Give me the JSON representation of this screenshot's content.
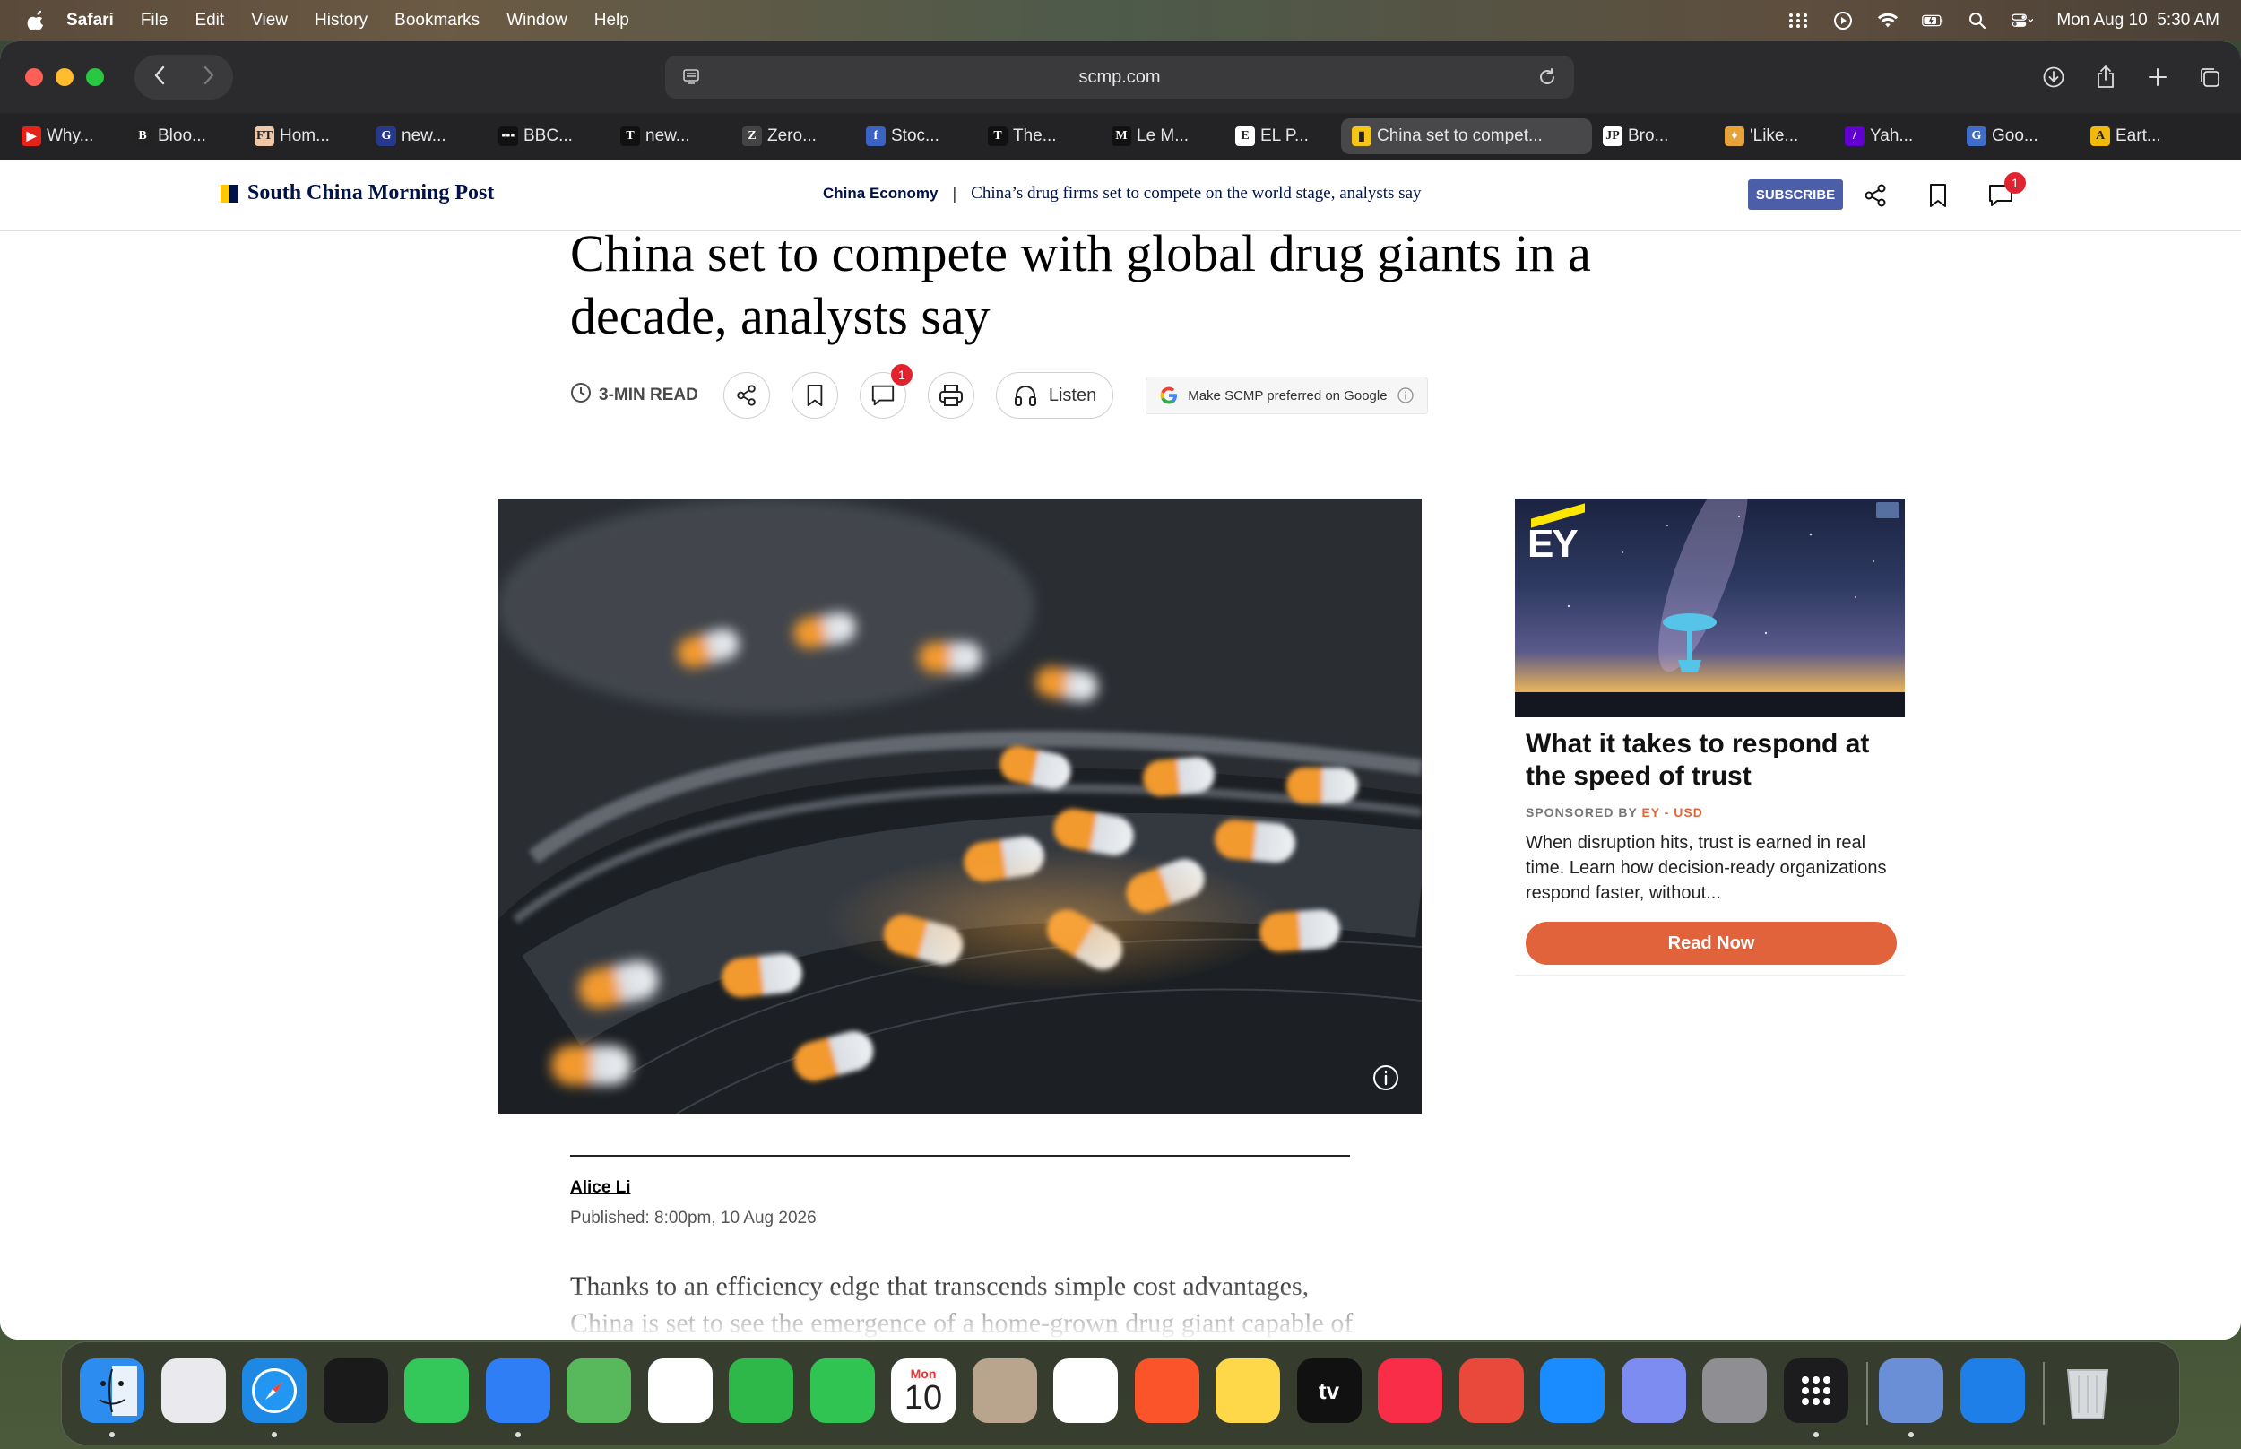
{
  "menubar": {
    "app_name": "Safari",
    "menus": [
      "File",
      "Edit",
      "View",
      "History",
      "Bookmarks",
      "Window",
      "Help"
    ],
    "datetime": "Mon Aug 10  5:30 AM"
  },
  "browser": {
    "address": "scmp.com",
    "tabs": [
      {
        "label": "Why...",
        "fav": "▶",
        "color": "#e62117"
      },
      {
        "label": "Bloo...",
        "fav": "B",
        "color": "#222"
      },
      {
        "label": "Hom...",
        "fav": "FT",
        "color": "#f0c8a8"
      },
      {
        "label": "new...",
        "fav": "G",
        "color": "#27388f"
      },
      {
        "label": "BBC...",
        "fav": "▪▪▪",
        "color": "#111"
      },
      {
        "label": "new...",
        "fav": "T",
        "color": "#111"
      },
      {
        "label": "Zero...",
        "fav": "Z",
        "color": "#444"
      },
      {
        "label": "Stoc...",
        "fav": "f",
        "color": "#3b63c4"
      },
      {
        "label": "The...",
        "fav": "T",
        "color": "#111"
      },
      {
        "label": "Le M...",
        "fav": "M",
        "color": "#111"
      },
      {
        "label": "EL P...",
        "fav": "E",
        "color": "#fff"
      },
      {
        "label": "China set to compet...",
        "fav": "▮",
        "color": "#f5c518",
        "active": true
      },
      {
        "label": "Bro...",
        "fav": "JP",
        "color": "#fff"
      },
      {
        "label": "'Like...",
        "fav": "♦",
        "color": "#e8a23a"
      },
      {
        "label": "Yah...",
        "fav": "/",
        "color": "#6001d2"
      },
      {
        "label": "Goo...",
        "fav": "G",
        "color": "#3f6ec9"
      },
      {
        "label": "Eart...",
        "fav": "A",
        "color": "#f2b90a"
      }
    ]
  },
  "site": {
    "logo": "South China Morning Post",
    "section": "China Economy",
    "separator": "|",
    "header_headline": "China’s drug firms set to compete on the world stage, analysts say",
    "subscribe": "SUBSCRIBE",
    "comment_count": "1"
  },
  "article": {
    "title": "China set to compete with global drug giants in a decade, analysts say",
    "read_time": "3-MIN READ",
    "listen": "Listen",
    "google_pref": "Make SCMP preferred on Google",
    "comment_count": "1",
    "author": "Alice Li",
    "published": "Published: 8:00pm, 10 Aug 2026",
    "body": "Thanks to an efficiency edge that transcends simple cost advantages, China is set to see the emergence of a home-grown drug giant capable of competing with global players in a decade, analysts say."
  },
  "ad": {
    "logo": "EY",
    "title": "What it takes to respond at the speed of trust",
    "sponsored_label": "SPONSORED BY",
    "sponsor": "EY - USD",
    "body": "When disruption hits, trust is earned in real time. Learn how decision-ready organizations respond faster, without...",
    "cta": "Read Now"
  },
  "dock": {
    "calendar_month": "Mon",
    "calendar_day": "10",
    "tv_label": "tv",
    "apps": [
      {
        "name": "finder",
        "color": "#2d8cf0"
      },
      {
        "name": "launchpad",
        "color": "#e9e9ee"
      },
      {
        "name": "safari",
        "color": "#1e88e5"
      },
      {
        "name": "podcast-app",
        "color": "#1a1a1a"
      },
      {
        "name": "messages",
        "color": "#34c759"
      },
      {
        "name": "mail",
        "color": "#2f7ef5"
      },
      {
        "name": "maps",
        "color": "#58b85c"
      },
      {
        "name": "photos",
        "color": "#ffffff"
      },
      {
        "name": "facetime",
        "color": "#2fb84a"
      },
      {
        "name": "phone",
        "color": "#30c453"
      },
      {
        "name": "calendar",
        "color": "#ffffff"
      },
      {
        "name": "contacts",
        "color": "#b9a58d"
      },
      {
        "name": "reminders",
        "color": "#ffffff"
      },
      {
        "name": "brave",
        "color": "#fb542b"
      },
      {
        "name": "notes",
        "color": "#ffd84a"
      },
      {
        "name": "apple-tv",
        "color": "#111111"
      },
      {
        "name": "music",
        "color": "#fa2d48"
      },
      {
        "name": "rocket-typist",
        "color": "#e8493b"
      },
      {
        "name": "app-store",
        "color": "#1a8cff"
      },
      {
        "name": "iphone-mirroring",
        "color": "#7d8cf0"
      },
      {
        "name": "system-settings",
        "color": "#8e8e93"
      },
      {
        "name": "app-grid",
        "color": "#1c1c1e"
      },
      {
        "name": "disk-utility",
        "color": "#6b8fd6"
      },
      {
        "name": "quicktime",
        "color": "#1f7fe8"
      },
      {
        "name": "trash",
        "color": "#cfd2d6"
      }
    ]
  }
}
